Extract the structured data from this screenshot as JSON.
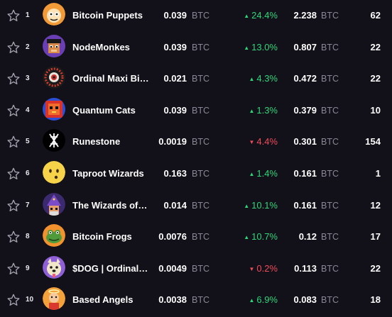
{
  "collections": [
    {
      "rank": "1",
      "name": "Bitcoin Puppets",
      "price": "0.039",
      "price_unit": "BTC",
      "change": "24.4%",
      "direction": "up",
      "volume": "2.238",
      "volume_unit": "BTC",
      "count": "62",
      "avatar": "orange-puppet-avatar"
    },
    {
      "rank": "2",
      "name": "NodeMonkes",
      "price": "0.039",
      "price_unit": "BTC",
      "change": "13.0%",
      "direction": "up",
      "volume": "0.807",
      "volume_unit": "BTC",
      "count": "22",
      "avatar": "pixel-monkey-avatar"
    },
    {
      "rank": "3",
      "name": "Ordinal Maxi Bi…",
      "price": "0.021",
      "price_unit": "BTC",
      "change": "4.3%",
      "direction": "up",
      "volume": "0.472",
      "volume_unit": "BTC",
      "count": "22",
      "avatar": "red-pattern-avatar"
    },
    {
      "rank": "4",
      "name": "Quantum Cats",
      "price": "0.039",
      "price_unit": "BTC",
      "change": "1.3%",
      "direction": "up",
      "volume": "0.379",
      "volume_unit": "BTC",
      "count": "10",
      "avatar": "pixel-cat-avatar"
    },
    {
      "rank": "5",
      "name": "Runestone",
      "price": "0.0019",
      "price_unit": "BTC",
      "change": "4.4%",
      "direction": "down",
      "volume": "0.301",
      "volume_unit": "BTC",
      "count": "154",
      "avatar": "runestone-logo-avatar"
    },
    {
      "rank": "6",
      "name": "Taproot Wizards",
      "price": "0.163",
      "price_unit": "BTC",
      "change": "1.4%",
      "direction": "up",
      "volume": "0.161",
      "volume_unit": "BTC",
      "count": "1",
      "avatar": "yellow-face-avatar"
    },
    {
      "rank": "7",
      "name": "The Wizards of…",
      "price": "0.014",
      "price_unit": "BTC",
      "change": "10.1%",
      "direction": "up",
      "volume": "0.161",
      "volume_unit": "BTC",
      "count": "12",
      "avatar": "wizard-avatar"
    },
    {
      "rank": "8",
      "name": "Bitcoin Frogs",
      "price": "0.0076",
      "price_unit": "BTC",
      "change": "10.7%",
      "direction": "up",
      "volume": "0.12",
      "volume_unit": "BTC",
      "count": "17",
      "avatar": "frog-avatar"
    },
    {
      "rank": "9",
      "name": "$DOG | Ordinal…",
      "price": "0.0049",
      "price_unit": "BTC",
      "change": "0.2%",
      "direction": "down",
      "volume": "0.113",
      "volume_unit": "BTC",
      "count": "22",
      "avatar": "dog-avatar"
    },
    {
      "rank": "10",
      "name": "Based Angels",
      "price": "0.0038",
      "price_unit": "BTC",
      "change": "6.9%",
      "direction": "up",
      "volume": "0.083",
      "volume_unit": "BTC",
      "count": "18",
      "avatar": "angel-avatar"
    }
  ],
  "colors": {
    "background": "#121018",
    "up": "#2ed67a",
    "down": "#ef4c5a",
    "muted": "#8b8796"
  },
  "icons": {
    "favorite": "star-outline-icon",
    "up": "triangle-up-icon",
    "down": "triangle-down-icon"
  }
}
